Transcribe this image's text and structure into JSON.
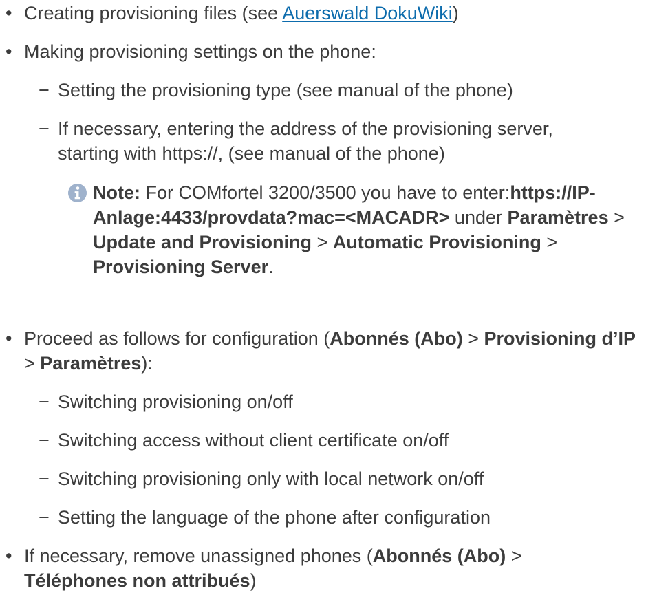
{
  "items": [
    {
      "a": "Creating provisioning files (see ",
      "link": "Auerswald DokuWiki",
      "b": ")"
    },
    {
      "a": "Making provisioning settings on the phone:"
    },
    {
      "a": "Setting the provisioning type (see manual of the phone)"
    },
    {
      "a": "If necessary, entering the address of the provisioning server, starting with https://, (see manual of the phone)"
    },
    {
      "label": "Note:",
      "t1": " For COMfortel 3200/3500 you have to enter:",
      "url": "https://IP-Anlage:4433/provdata?mac=<MACADR>",
      "t2": " under ",
      "p1": "Paramètres",
      "sep1": " > ",
      "p2": "Update and Provisioning",
      "sep2": " > ",
      "p3": "Automatic Provisioning",
      "sep3": " > ",
      "p4": "Provisioning Server",
      "end": "."
    },
    {
      "a": "Proceed as follows for configuration (",
      "p1": "Abonnés (Abo)",
      "sep1": " > ",
      "p2": "Provisioning d’IP",
      "sep2": " > ",
      "p3": "Paramètres",
      "end": "):"
    },
    {
      "a": "Switching provisioning on/off"
    },
    {
      "a": "Switching access without client certificate on/off"
    },
    {
      "a": "Switching provisioning only with local network on/off"
    },
    {
      "a": "Setting the language of the phone after configuration"
    },
    {
      "a": "If necessary, remove unassigned phones (",
      "p1": "Abonnés (Abo)",
      "sep1": " > ",
      "p2": "Téléphones non attribués",
      "end": ")"
    }
  ],
  "icons": {
    "note": "info-icon"
  },
  "colors": {
    "text": "#3c3c3c",
    "link": "#0d6cad",
    "info_icon": "#9fb2cc"
  }
}
